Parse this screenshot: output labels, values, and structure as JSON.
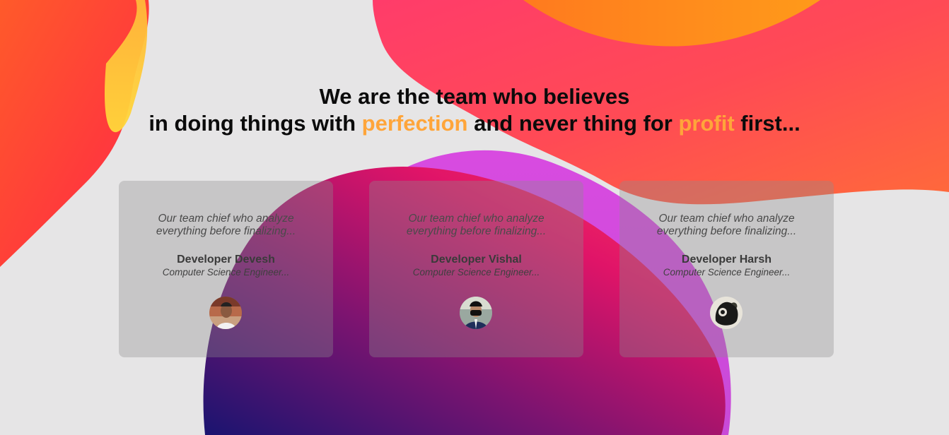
{
  "headline": {
    "line1": "We are the team who believes",
    "line2_part1": "in doing things with ",
    "highlight1": "perfection",
    "line2_part2": " and never thing for ",
    "highlight2": "profit",
    "line2_part3": " first..."
  },
  "colors": {
    "highlight": "#ffa53a",
    "background": "#e6e5e6"
  },
  "team": [
    {
      "quote": "Our team chief who analyze everything before finalizing...",
      "name": "Developer Devesh",
      "role": "Computer Science Engineer...",
      "avatar_icon": "profile-photo-icon"
    },
    {
      "quote": "Our team chief who analyze everything before finalizing...",
      "name": "Developer Vishal",
      "role": "Computer Science Engineer...",
      "avatar_icon": "profile-photo-icon"
    },
    {
      "quote": "Our team chief who analyze everything before finalizing...",
      "name": "Developer Harsh",
      "role": "Computer Science Engineer...",
      "avatar_icon": "profile-photo-icon"
    }
  ]
}
